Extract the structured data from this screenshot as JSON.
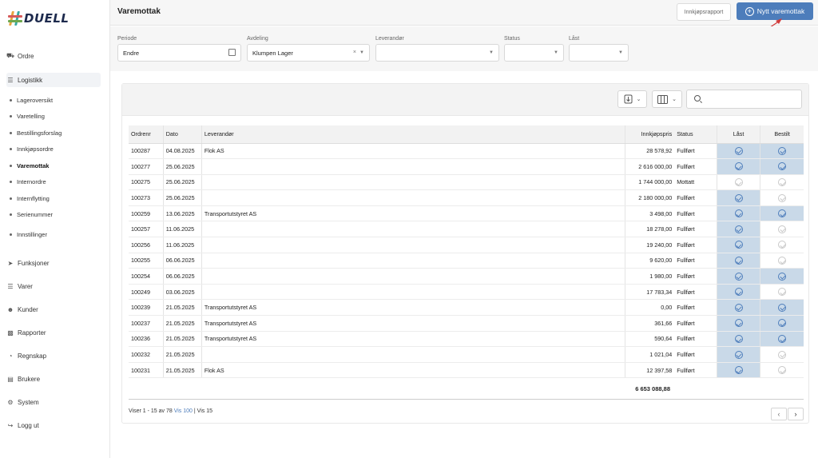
{
  "app": {
    "logo_text": "DUELL"
  },
  "sidebar": {
    "top_items": [
      {
        "label": "Ordre",
        "icon": "truck-icon"
      }
    ],
    "logistics": {
      "label": "Logistikk",
      "icon": "list-icon"
    },
    "sub_items": [
      "Lageroversikt",
      "Varetelling",
      "Bestillingsforslag",
      "Innkjøpsordre",
      "Varemottak",
      "Internordre",
      "Internflytting",
      "Serienummer"
    ],
    "settings": "Innstillinger",
    "bottom_items": [
      {
        "label": "Funksjoner",
        "icon": "rocket-icon"
      },
      {
        "label": "Varer",
        "icon": "barcode-icon"
      },
      {
        "label": "Kunder",
        "icon": "users-icon"
      },
      {
        "label": "Rapporter",
        "icon": "chart-icon"
      },
      {
        "label": "Regnskap",
        "icon": "pie-icon"
      },
      {
        "label": "Brukere",
        "icon": "id-card-icon"
      },
      {
        "label": "System",
        "icon": "gears-icon"
      },
      {
        "label": "Logg ut",
        "icon": "logout-icon"
      }
    ]
  },
  "header": {
    "title": "Varemottak",
    "report_label": "Innkjøpsrapport",
    "new_label": "Nytt varemottak",
    "accent": "#4d7dbb"
  },
  "filters": {
    "periode": {
      "label": "Periode",
      "value": "Endre"
    },
    "avdeling": {
      "label": "Avdeling",
      "value": "Klumpen Lager"
    },
    "leverandor": {
      "label": "Leverandør",
      "value": ""
    },
    "status": {
      "label": "Status",
      "value": ""
    },
    "last": {
      "label": "Låst",
      "value": ""
    }
  },
  "table": {
    "headers": {
      "ordrenr": "Ordrenr",
      "dato": "Dato",
      "leverandor": "Leverandør",
      "pris": "Innkjøpspris",
      "status": "Status",
      "last": "Låst",
      "bestilt": "Bestilt"
    },
    "rows": [
      {
        "ordrenr": "100287",
        "dato": "04.08.2025",
        "leverandor": "Flok AS",
        "pris": "28 578,92",
        "status": "Fullført",
        "last": true,
        "bestilt": true
      },
      {
        "ordrenr": "100277",
        "dato": "25.06.2025",
        "leverandor": "",
        "pris": "2 616 000,00",
        "status": "Fullført",
        "last": true,
        "bestilt": true
      },
      {
        "ordrenr": "100275",
        "dato": "25.06.2025",
        "leverandor": "",
        "pris": "1 744 000,00",
        "status": "Mottatt",
        "last": false,
        "bestilt": false
      },
      {
        "ordrenr": "100273",
        "dato": "25.06.2025",
        "leverandor": "",
        "pris": "2 180 000,00",
        "status": "Fullført",
        "last": true,
        "bestilt": false
      },
      {
        "ordrenr": "100259",
        "dato": "13.06.2025",
        "leverandor": "Transportutstyret AS",
        "pris": "3 498,00",
        "status": "Fullført",
        "last": true,
        "bestilt": true
      },
      {
        "ordrenr": "100257",
        "dato": "11.06.2025",
        "leverandor": "",
        "pris": "18 278,00",
        "status": "Fullført",
        "last": true,
        "bestilt": false
      },
      {
        "ordrenr": "100256",
        "dato": "11.06.2025",
        "leverandor": "",
        "pris": "19 240,00",
        "status": "Fullført",
        "last": true,
        "bestilt": false
      },
      {
        "ordrenr": "100255",
        "dato": "06.06.2025",
        "leverandor": "",
        "pris": "9 620,00",
        "status": "Fullført",
        "last": true,
        "bestilt": false
      },
      {
        "ordrenr": "100254",
        "dato": "06.06.2025",
        "leverandor": "",
        "pris": "1 980,00",
        "status": "Fullført",
        "last": true,
        "bestilt": true
      },
      {
        "ordrenr": "100249",
        "dato": "03.06.2025",
        "leverandor": "",
        "pris": "17 783,34",
        "status": "Fullført",
        "last": true,
        "bestilt": false
      },
      {
        "ordrenr": "100239",
        "dato": "21.05.2025",
        "leverandor": "Transportutstyret AS",
        "pris": "0,00",
        "status": "Fullført",
        "last": true,
        "bestilt": true
      },
      {
        "ordrenr": "100237",
        "dato": "21.05.2025",
        "leverandor": "Transportutstyret AS",
        "pris": "361,66",
        "status": "Fullført",
        "last": true,
        "bestilt": true
      },
      {
        "ordrenr": "100236",
        "dato": "21.05.2025",
        "leverandor": "Transportutstyret AS",
        "pris": "590,64",
        "status": "Fullført",
        "last": true,
        "bestilt": true
      },
      {
        "ordrenr": "100232",
        "dato": "21.05.2025",
        "leverandor": "",
        "pris": "1 021,04",
        "status": "Fullført",
        "last": true,
        "bestilt": false
      },
      {
        "ordrenr": "100231",
        "dato": "21.05.2025",
        "leverandor": "Flok AS",
        "pris": "12 397,58",
        "status": "Fullført",
        "last": true,
        "bestilt": false
      }
    ],
    "total": "6 653 088,88"
  },
  "pager": {
    "info": "Viser 1 - 15 av 78",
    "vis100": "Vis 100",
    "vis15": "Vis 15",
    "prev": "‹",
    "next": "›"
  }
}
